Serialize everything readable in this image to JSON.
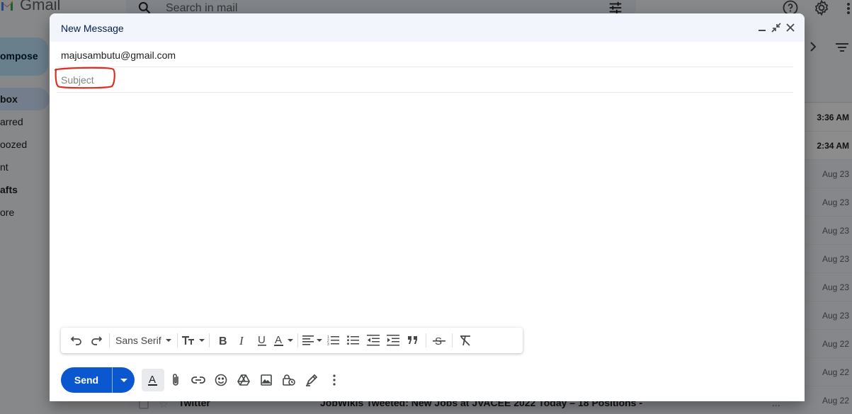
{
  "app": {
    "name": "Gmail",
    "search_placeholder": "Search in mail"
  },
  "sidebar": {
    "compose_label": "ompose",
    "items": [
      {
        "label": "box",
        "active": true
      },
      {
        "label": "arred"
      },
      {
        "label": "oozed"
      },
      {
        "label": "nt"
      },
      {
        "label": "afts",
        "bold": true
      },
      {
        "label": "ore"
      }
    ]
  },
  "mail_list": {
    "times": [
      "3:36 AM",
      "2:34 AM",
      "Aug 23",
      "Aug 23",
      "Aug 23",
      "Aug 23",
      "Aug 23",
      "Aug 23",
      "Aug 22",
      "Aug 22",
      "Aug 22"
    ],
    "bottom_row": {
      "sender": "Twitter",
      "subject": "JobWikis Tweeted: New Jobs at JVACEE 2022 Today – 18 Positions -",
      "more": "..."
    }
  },
  "compose": {
    "title": "New Message",
    "to": "majusambutu@gmail.com",
    "subject_placeholder": "Subject",
    "subject_value": "",
    "body": "",
    "font_family_label": "Sans Serif",
    "send_label": "Send",
    "annotation_color": "#d93025"
  },
  "colors": {
    "accent": "#0b57d0",
    "compose_bg": "#c2e7ff",
    "header_bg": "#f2f6fc"
  }
}
